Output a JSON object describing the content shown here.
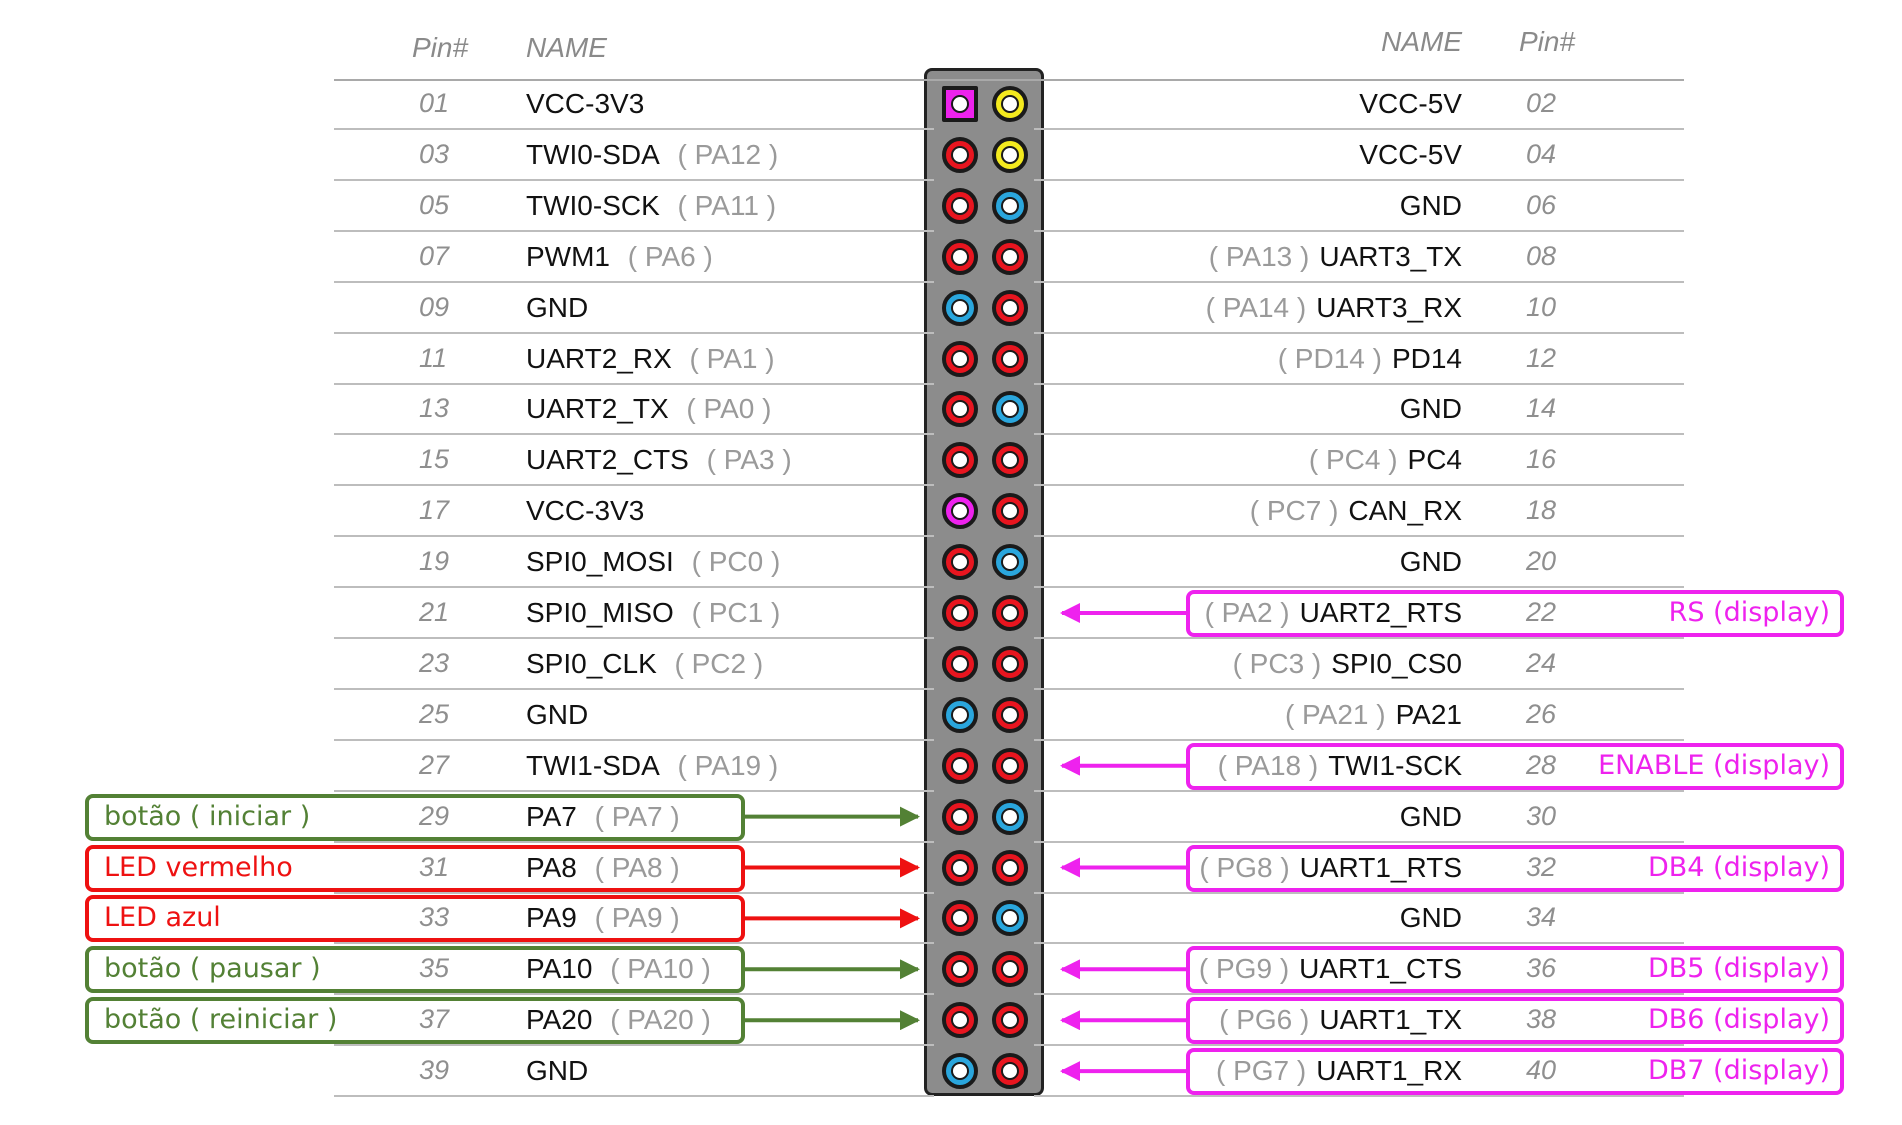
{
  "header": {
    "left_pin": "Pin#",
    "left_name": "NAME",
    "right_name": "NAME",
    "right_pin": "Pin#"
  },
  "colors": {
    "red": "#e8151f",
    "blue": "#2aa6dd",
    "yellow": "#f4ea1e",
    "magenta": "#ee22ee",
    "green": "#538135",
    "annotation_red": "#ee1111"
  },
  "rows": [
    {
      "left": {
        "pin": "01",
        "name": "VCC-3V3",
        "port": "",
        "color": "magenta",
        "square": true
      },
      "right": {
        "pin": "02",
        "name": "VCC-5V",
        "port": "",
        "color": "yellow"
      }
    },
    {
      "left": {
        "pin": "03",
        "name": "TWI0-SDA",
        "port": "( PA12 )",
        "color": "red"
      },
      "right": {
        "pin": "04",
        "name": "VCC-5V",
        "port": "",
        "color": "yellow"
      }
    },
    {
      "left": {
        "pin": "05",
        "name": "TWI0-SCK",
        "port": "( PA11 )",
        "color": "red"
      },
      "right": {
        "pin": "06",
        "name": "GND",
        "port": "",
        "color": "blue"
      }
    },
    {
      "left": {
        "pin": "07",
        "name": "PWM1",
        "port": "( PA6 )",
        "color": "red"
      },
      "right": {
        "pin": "08",
        "name": "UART3_TX",
        "port": "( PA13 )",
        "color": "red"
      }
    },
    {
      "left": {
        "pin": "09",
        "name": "GND",
        "port": "",
        "color": "blue"
      },
      "right": {
        "pin": "10",
        "name": "UART3_RX",
        "port": "( PA14 )",
        "color": "red"
      }
    },
    {
      "left": {
        "pin": "11",
        "name": "UART2_RX",
        "port": "( PA1 )",
        "color": "red"
      },
      "right": {
        "pin": "12",
        "name": "PD14",
        "port": "( PD14 )",
        "color": "red"
      }
    },
    {
      "left": {
        "pin": "13",
        "name": "UART2_TX",
        "port": "( PA0 )",
        "color": "red"
      },
      "right": {
        "pin": "14",
        "name": "GND",
        "port": "",
        "color": "blue"
      }
    },
    {
      "left": {
        "pin": "15",
        "name": "UART2_CTS",
        "port": "( PA3 )",
        "color": "red"
      },
      "right": {
        "pin": "16",
        "name": "PC4",
        "port": "(  PC4 )",
        "color": "red"
      }
    },
    {
      "left": {
        "pin": "17",
        "name": "VCC-3V3",
        "port": "",
        "color": "magenta"
      },
      "right": {
        "pin": "18",
        "name": "CAN_RX",
        "port": "( PC7 )",
        "color": "red"
      }
    },
    {
      "left": {
        "pin": "19",
        "name": "SPI0_MOSI",
        "port": "( PC0 )",
        "color": "red"
      },
      "right": {
        "pin": "20",
        "name": "GND",
        "port": "",
        "color": "blue"
      }
    },
    {
      "left": {
        "pin": "21",
        "name": "SPI0_MISO",
        "port": "( PC1 )",
        "color": "red"
      },
      "right": {
        "pin": "22",
        "name": "UART2_RTS",
        "port": "( PA2 )",
        "color": "red"
      }
    },
    {
      "left": {
        "pin": "23",
        "name": "SPI0_CLK",
        "port": "( PC2 )",
        "color": "red"
      },
      "right": {
        "pin": "24",
        "name": "SPI0_CS0",
        "port": "( PC3 )",
        "color": "red"
      }
    },
    {
      "left": {
        "pin": "25",
        "name": "GND",
        "port": "",
        "color": "blue"
      },
      "right": {
        "pin": "26",
        "name": "PA21",
        "port": "( PA21 )",
        "color": "red"
      }
    },
    {
      "left": {
        "pin": "27",
        "name": "TWI1-SDA",
        "port": "( PA19 )",
        "color": "red"
      },
      "right": {
        "pin": "28",
        "name": "TWI1-SCK",
        "port": "( PA18 )",
        "color": "red"
      }
    },
    {
      "left": {
        "pin": "29",
        "name": "PA7",
        "port": "( PA7 )",
        "color": "red"
      },
      "right": {
        "pin": "30",
        "name": "GND",
        "port": "",
        "color": "blue"
      }
    },
    {
      "left": {
        "pin": "31",
        "name": "PA8",
        "port": "( PA8 )",
        "color": "red"
      },
      "right": {
        "pin": "32",
        "name": "UART1_RTS",
        "port": "( PG8 )",
        "color": "red"
      }
    },
    {
      "left": {
        "pin": "33",
        "name": "PA9",
        "port": "( PA9 )",
        "color": "red"
      },
      "right": {
        "pin": "34",
        "name": "GND",
        "port": "",
        "color": "blue"
      }
    },
    {
      "left": {
        "pin": "35",
        "name": "PA10",
        "port": "( PA10 )",
        "color": "red"
      },
      "right": {
        "pin": "36",
        "name": "UART1_CTS",
        "port": "( PG9 )",
        "color": "red"
      }
    },
    {
      "left": {
        "pin": "37",
        "name": "PA20",
        "port": "( PA20 )",
        "color": "red"
      },
      "right": {
        "pin": "38",
        "name": "UART1_TX",
        "port": "( PG6 )",
        "color": "red"
      }
    },
    {
      "left": {
        "pin": "39",
        "name": "GND",
        "port": "",
        "color": "blue"
      },
      "right": {
        "pin": "40",
        "name": "UART1_RX",
        "port": "( PG7 )",
        "color": "red"
      }
    }
  ],
  "left_annotations": [
    {
      "row": 14,
      "label": "botão ( iniciar )",
      "color": "green"
    },
    {
      "row": 15,
      "label": "LED vermelho",
      "color": "annotation_red"
    },
    {
      "row": 16,
      "label": "LED azul",
      "color": "annotation_red"
    },
    {
      "row": 17,
      "label": "botão ( pausar )",
      "color": "green"
    },
    {
      "row": 18,
      "label": "botão ( reiniciar )",
      "color": "green"
    }
  ],
  "right_annotations": [
    {
      "row": 10,
      "label": "RS (display)"
    },
    {
      "row": 13,
      "label": "ENABLE (display)"
    },
    {
      "row": 15,
      "label": "DB4 (display)"
    },
    {
      "row": 17,
      "label": "DB5 (display)"
    },
    {
      "row": 18,
      "label": "DB6 (display)"
    },
    {
      "row": 19,
      "label": "DB7 (display)"
    }
  ]
}
